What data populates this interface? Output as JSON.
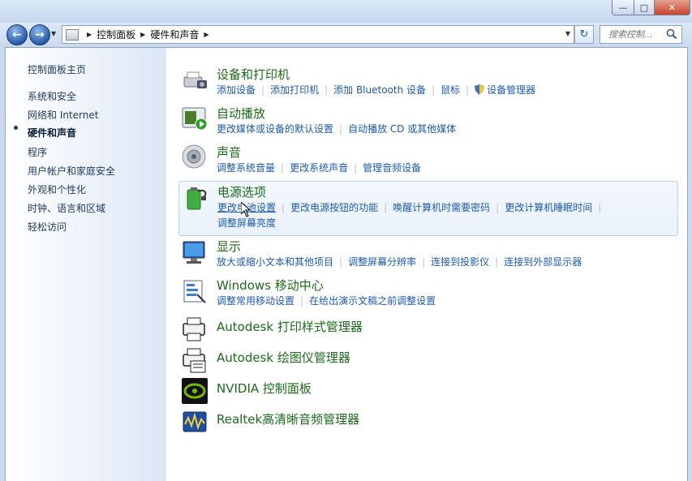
{
  "window": {
    "controls": {
      "minimize": "—",
      "maximize": "□",
      "close": "✕"
    }
  },
  "nav": {
    "back_icon": "arrow-left-icon",
    "forward_icon": "arrow-right-icon",
    "breadcrumb": [
      "控制面板",
      "硬件和声音"
    ],
    "search_placeholder": "搜索控制..."
  },
  "sidebar": {
    "items": [
      {
        "label": "控制面板主页"
      },
      {
        "label": "系统和安全"
      },
      {
        "label": "网络和 Internet"
      },
      {
        "label": "硬件和声音",
        "current": true
      },
      {
        "label": "程序"
      },
      {
        "label": "用户帐户和家庭安全"
      },
      {
        "label": "外观和个性化"
      },
      {
        "label": "时钟、语言和区域"
      },
      {
        "label": "轻松访问"
      }
    ]
  },
  "categories": [
    {
      "title": "设备和打印机",
      "icon": "printer-camera-icon",
      "links": [
        "添加设备",
        "添加打印机",
        "添加 Bluetooth 设备",
        "鼠标",
        "设备管理器"
      ]
    },
    {
      "title": "自动播放",
      "icon": "autoplay-icon",
      "links": [
        "更改媒体或设备的默认设置",
        "自动播放 CD 或其他媒体"
      ]
    },
    {
      "title": "声音",
      "icon": "speaker-icon",
      "links": [
        "调整系统音量",
        "更改系统声音",
        "管理音频设备"
      ]
    },
    {
      "title": "电源选项",
      "icon": "battery-plug-icon",
      "links": [
        "更改电池设置",
        "更改电源按钮的功能",
        "唤醒计算机时需要密码",
        "更改计算机睡眠时间"
      ],
      "links_row2": [
        "调整屏幕亮度"
      ]
    },
    {
      "title": "显示",
      "icon": "monitor-icon",
      "links": [
        "放大或缩小文本和其他项目",
        "调整屏幕分辨率",
        "连接到投影仪",
        "连接到外部显示器"
      ]
    },
    {
      "title": "Windows 移动中心",
      "icon": "mobility-center-icon",
      "links": [
        "调整常用移动设置",
        "在给出演示文稿之前调整设置"
      ]
    },
    {
      "title": "Autodesk 打印样式管理器",
      "icon": "print-style-manager-icon",
      "links": []
    },
    {
      "title": "Autodesk 绘图仪管理器",
      "icon": "plotter-manager-icon",
      "links": []
    },
    {
      "title": "NVIDIA 控制面板",
      "icon": "nvidia-icon",
      "links": []
    },
    {
      "title": "Realtek高清晰音频管理器",
      "icon": "realtek-audio-icon",
      "links": []
    }
  ],
  "colors": {
    "category_title": "#1b6b1b",
    "link": "#1e5aad",
    "sidebar_text": "#1e395b",
    "highlight_bg": "#e9f1fb"
  }
}
